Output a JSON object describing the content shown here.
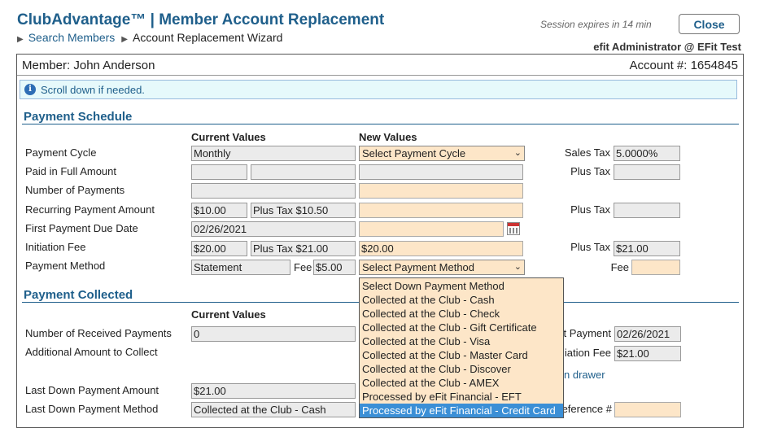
{
  "header": {
    "title": "ClubAdvantage™ | Member Account Replacement",
    "breadcrumb_link": "Search Members",
    "breadcrumb_current": "Account Replacement Wizard",
    "session": "Session expires in 14 min",
    "close_label": "Close",
    "user": "efit Administrator @ EFit Test"
  },
  "member": {
    "label": "Member: John Anderson",
    "account": "Account #: 1654845"
  },
  "info": {
    "text": "Scroll down if needed."
  },
  "schedule": {
    "title": "Payment Schedule",
    "current_header": "Current Values",
    "new_header": "New Values",
    "rows": {
      "cycle": {
        "label": "Payment Cycle",
        "current": "Monthly",
        "new": "Select Payment Cycle",
        "right_label": "Sales Tax",
        "right_value": "5.0000%"
      },
      "paid_full": {
        "label": "Paid in Full Amount",
        "right_label": "Plus Tax"
      },
      "num_payments": {
        "label": "Number of Payments"
      },
      "recurring": {
        "label": "Recurring Payment Amount",
        "current": "$10.00",
        "current_tax": "Plus Tax $10.50",
        "right_label": "Plus Tax"
      },
      "first_due": {
        "label": "First Payment Due Date",
        "current": "02/26/2021"
      },
      "initiation": {
        "label": "Initiation Fee",
        "current": "$20.00",
        "current_tax": "Plus Tax $21.00",
        "new": "$20.00",
        "right_label": "Plus Tax",
        "right_value": "$21.00"
      },
      "method": {
        "label": "Payment Method",
        "current": "Statement",
        "fee_label": "Fee",
        "fee_value": "$5.00",
        "new": "Select Payment Method",
        "right_label": "Fee"
      }
    }
  },
  "collected": {
    "title": "Payment Collected",
    "current_header": "Current Values",
    "rows": {
      "received": {
        "label": "Number of Received Payments",
        "current": "0",
        "right_label": "t Payment",
        "right_value": "02/26/2021"
      },
      "additional": {
        "label": "Additional Amount to Collect",
        "right_label": "iation Fee",
        "right_value": "$21.00"
      },
      "drawer": {
        "text": "n drawer"
      },
      "last_amount": {
        "label": "Last Down Payment Amount",
        "current": "$21.00"
      },
      "last_method": {
        "label": "Last Down Payment Method",
        "current": "Collected at the Club - Cash",
        "right_label": "eference #"
      }
    }
  },
  "dropdown": {
    "items": [
      "Select Down Payment Method",
      "Collected at the Club - Cash",
      "Collected at the Club - Check",
      "Collected at the Club - Gift Certificate",
      "Collected at the Club - Visa",
      "Collected at the Club - Master Card",
      "Collected at the Club - Discover",
      "Collected at the Club - AMEX",
      "Processed by eFit Financial - EFT",
      "Processed by eFit Financial - Credit Card"
    ],
    "selected_index": 9
  },
  "icons": {
    "info": "info-icon",
    "chevron": "chevron-down-icon",
    "calendar": "calendar-icon",
    "breadcrumb": "triangle-right-icon"
  },
  "colors": {
    "accent": "#1f5f8b",
    "new_field": "#fde6c8",
    "selected": "#3b8fd6"
  }
}
